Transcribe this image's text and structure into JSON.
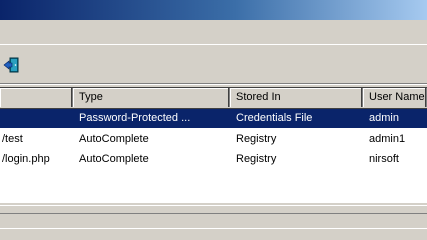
{
  "window": {
    "title_visible": false
  },
  "toolbar": {
    "exit_icon": "exit-door-icon"
  },
  "table": {
    "columns": [
      "",
      "Type",
      "Stored In",
      "User Name"
    ],
    "rows": [
      {
        "url": "",
        "type": "Password-Protected ...",
        "stored_in": "Credentials File",
        "user": "admin",
        "selected": true
      },
      {
        "url": "/test",
        "type": "AutoComplete",
        "stored_in": "Registry",
        "user": "admin1",
        "selected": false
      },
      {
        "url": "/login.php",
        "type": "AutoComplete",
        "stored_in": "Registry",
        "user": "nirsoft",
        "selected": false
      }
    ]
  },
  "colors": {
    "selection": "#0a246a",
    "face": "#d4d0c8"
  }
}
